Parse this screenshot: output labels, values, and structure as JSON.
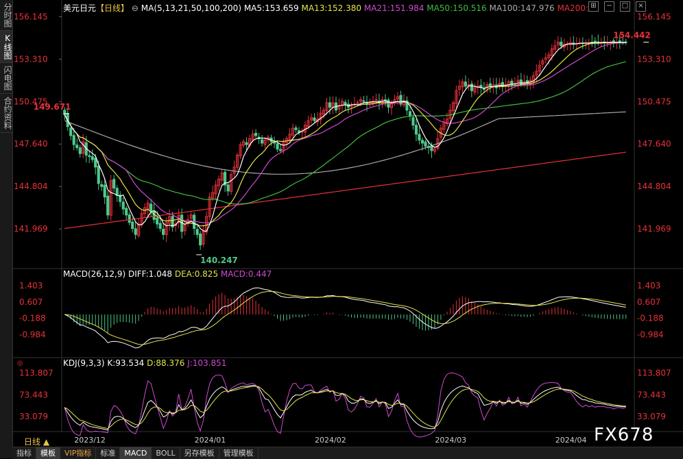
{
  "sidebar": {
    "tabs": [
      {
        "label": "分时图",
        "active": false
      },
      {
        "label": "K线图",
        "active": true
      },
      {
        "label": "闪电图",
        "active": false
      },
      {
        "label": "合约资料",
        "active": false
      }
    ]
  },
  "header": {
    "symbol": "美元日元",
    "period": "【日线】",
    "ma_spec": "MA(5,13,21,50,100,200)",
    "ma5": "MA5:153.659",
    "ma13": "MA13:152.380",
    "ma21": "MA21:151.984",
    "ma50": "MA50:150.516",
    "ma100": "MA100:147.976",
    "ma200": "MA200:"
  },
  "macd_header": {
    "title": "MACD(26,12,9)",
    "diff": "DIFF:1.048",
    "dea": "DEA:0.825",
    "macd": "MACD:0.447"
  },
  "kdj_header": {
    "title": "KDJ(9,3,3)",
    "k": "K:93.534",
    "d": "D:88.376",
    "j": "J:103.851"
  },
  "colors": {
    "up": "#e8313a",
    "down": "#4ec98c",
    "ma5": "#ffffff",
    "ma13": "#e6e64a",
    "ma21": "#d14ad1",
    "ma50": "#3fbf3f",
    "ma100": "#aaaaaa",
    "ma200": "#e8313a",
    "axis": "#e8313a",
    "diff": "#ffffff",
    "dea": "#e6e64a",
    "kdj_k": "#ffffff",
    "kdj_d": "#e6e64a",
    "kdj_j": "#d14ad1"
  },
  "bottom_tabs": [
    {
      "label": "指标",
      "active": false
    },
    {
      "label": "模板",
      "active": true
    },
    {
      "label": "VIP指标",
      "active": false,
      "vip": true
    },
    {
      "label": "标准",
      "active": false
    },
    {
      "label": "MACD",
      "active": true
    },
    {
      "label": "BOLL",
      "active": false
    },
    {
      "label": "另存模板",
      "active": false
    },
    {
      "label": "管理模板",
      "active": false
    }
  ],
  "period_label": "日线 ▲",
  "watermark": "FX678",
  "chart_data": {
    "type": "candlestick",
    "title": "美元日元【日线】",
    "price_ticks": [
      "156.145",
      "153.310",
      "150.475",
      "147.640",
      "144.804",
      "141.969"
    ],
    "price_tick_values": [
      156.145,
      153.31,
      150.475,
      147.64,
      144.804,
      141.969
    ],
    "ylim": [
      139.6,
      156.8
    ],
    "x_labels": [
      "2023/12",
      "2024/01",
      "2024/02",
      "2024/03",
      "2024/04"
    ],
    "x_label_index": [
      8,
      47,
      86,
      125,
      164
    ],
    "annotations": [
      {
        "text": "149.671",
        "index": 1,
        "value": 149.671
      },
      {
        "text": "140.247",
        "index": 44,
        "value": 140.247
      },
      {
        "text": "154.442",
        "index": 189,
        "value": 154.442
      }
    ],
    "close": [
      149.6,
      148.8,
      148.2,
      147.6,
      147.4,
      147.0,
      147.8,
      146.9,
      146.8,
      146.6,
      146.1,
      145.0,
      144.8,
      144.1,
      142.9,
      145.2,
      144.7,
      144.2,
      143.8,
      143.3,
      142.9,
      142.4,
      142.0,
      141.6,
      142.3,
      143.0,
      143.4,
      143.7,
      143.2,
      142.6,
      142.3,
      142.0,
      141.6,
      142.4,
      142.8,
      142.1,
      142.3,
      142.9,
      141.8,
      142.3,
      142.6,
      142.9,
      142.0,
      141.6,
      140.9,
      141.8,
      142.8,
      144.1,
      144.4,
      144.9,
      145.3,
      145.7,
      144.9,
      144.5,
      145.6,
      146.1,
      146.9,
      147.6,
      147.8,
      147.6,
      148.0,
      148.3,
      148.2,
      148.0,
      147.7,
      147.9,
      148.1,
      147.8,
      147.7,
      147.3,
      147.2,
      147.8,
      148.0,
      148.3,
      148.7,
      148.6,
      148.4,
      148.5,
      148.9,
      149.2,
      149.4,
      149.2,
      149.3,
      149.7,
      149.9,
      150.4,
      150.1,
      150.4,
      149.9,
      150.2,
      150.5,
      150.3,
      150.1,
      150.2,
      150.3,
      150.4,
      150.6,
      150.5,
      150.3,
      150.4,
      150.5,
      150.6,
      150.4,
      150.6,
      150.5,
      150.1,
      150.4,
      150.6,
      150.8,
      150.3,
      150.5,
      149.9,
      149.5,
      148.9,
      148.3,
      147.9,
      147.7,
      147.5,
      147.4,
      147.2,
      147.3,
      148.0,
      148.7,
      149.1,
      149.3,
      149.9,
      150.4,
      151.2,
      151.5,
      151.8,
      151.5,
      151.6,
      151.2,
      151.4,
      151.5,
      151.4,
      151.3,
      151.6,
      151.5,
      151.6,
      151.4,
      151.7,
      151.5,
      151.6,
      151.8,
      151.6,
      151.7,
      151.9,
      151.6,
      151.8,
      151.7,
      151.9,
      152.2,
      152.5,
      152.9,
      153.2,
      153.4,
      153.6,
      154.0,
      154.2,
      154.44,
      154.2,
      154.3,
      154.35,
      154.4,
      154.3,
      154.35,
      154.4,
      154.38,
      154.42,
      154.4,
      154.44,
      154.4,
      154.42,
      154.43,
      154.44,
      154.42,
      154.44,
      154.41,
      154.44,
      154.43,
      154.42,
      154.44
    ],
    "macd_ticks": [
      "1.403",
      "0.607",
      "-0.188",
      "-0.984"
    ],
    "macd_tick_values": [
      1.403,
      0.607,
      -0.188,
      -0.984
    ],
    "macd_ylim": [
      -1.9,
      1.9
    ],
    "kdj_ticks": [
      "113.807",
      "73.443",
      "33.079"
    ],
    "kdj_tick_values": [
      113.807,
      73.443,
      33.079
    ],
    "kdj_ylim": [
      5,
      130
    ]
  }
}
